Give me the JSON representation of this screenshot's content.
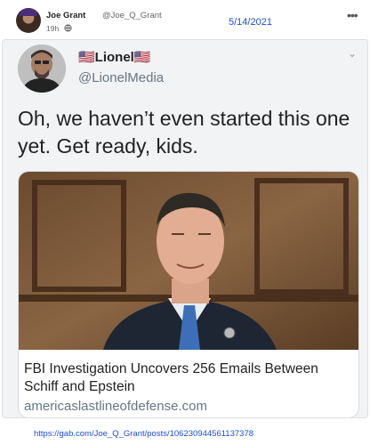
{
  "gab_post": {
    "author_name": "Joe Grant",
    "author_handle": "@Joe_Q_Grant",
    "time_ago": "19h",
    "date": "5/14/2021",
    "more_icon": "ellipsis-icon",
    "visibility_icon": "globe-icon"
  },
  "tweet": {
    "author": "🇺🇸Lionel🇺🇸",
    "handle": "@LionelMedia",
    "text": "Oh, we haven’t even started this one yet. Get ready, kids.",
    "chevron_icon": "chevron-down-icon",
    "link_card": {
      "title": "FBI Investigation Uncovers 256 Emails Between Schiff and Epstein",
      "domain": "americaslastlineofdefense.com"
    }
  },
  "footer": {
    "post_url": "https://gab.com/Joe_Q_Grant/posts/106230944561137378"
  },
  "colors": {
    "link_blue": "#1a4fd6",
    "twitter_gray": "#657786"
  }
}
